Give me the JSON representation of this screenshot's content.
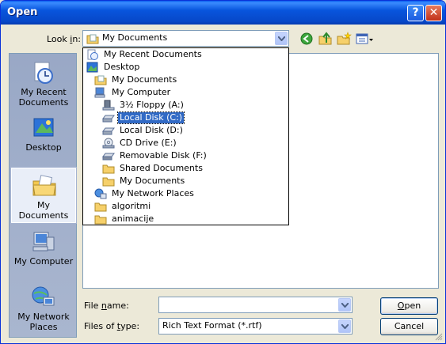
{
  "window": {
    "title": "Open",
    "help_symbol": "?",
    "close_symbol": "✕"
  },
  "look_in": {
    "label_prefix": "Look ",
    "label_accel": "i",
    "label_suffix": "n:",
    "value": "My Documents"
  },
  "toolbar": {
    "icons": [
      "back-icon",
      "up-folder-icon",
      "new-folder-icon",
      "views-menu-icon"
    ]
  },
  "places": [
    {
      "label": "My Recent Documents",
      "icon": "recent-documents-icon"
    },
    {
      "label": "Desktop",
      "icon": "desktop-icon"
    },
    {
      "label": "My Documents",
      "icon": "my-documents-icon",
      "selected": true
    },
    {
      "label": "My Computer",
      "icon": "my-computer-icon"
    },
    {
      "label": "My Network Places",
      "icon": "network-places-icon"
    }
  ],
  "dropdown": {
    "items": [
      {
        "label": "My Recent Documents",
        "icon": "recent-documents-icon",
        "indent": 0
      },
      {
        "label": "Desktop",
        "icon": "desktop-icon",
        "indent": 0
      },
      {
        "label": "My Documents",
        "icon": "folder-icon",
        "indent": 1
      },
      {
        "label": "My Computer",
        "icon": "computer-icon",
        "indent": 1
      },
      {
        "label": "3½ Floppy (A:)",
        "icon": "floppy-icon",
        "indent": 2
      },
      {
        "label": "Local Disk (C:)",
        "icon": "hard-disk-icon",
        "indent": 2,
        "active": true
      },
      {
        "label": "Local Disk (D:)",
        "icon": "hard-disk-icon",
        "indent": 2
      },
      {
        "label": "CD Drive (E:)",
        "icon": "cd-drive-icon",
        "indent": 2
      },
      {
        "label": "Removable Disk (F:)",
        "icon": "removable-disk-icon",
        "indent": 2
      },
      {
        "label": "Shared Documents",
        "icon": "folder-icon",
        "indent": 2
      },
      {
        "label": "My Documents",
        "icon": "folder-icon",
        "indent": 2
      },
      {
        "label": "My Network Places",
        "icon": "network-places-icon",
        "indent": 1
      },
      {
        "label": "algoritmi",
        "icon": "folder-icon",
        "indent": 1
      },
      {
        "label": "animacije",
        "icon": "folder-icon",
        "indent": 1
      }
    ]
  },
  "file_name": {
    "label_prefix": "File ",
    "label_accel": "n",
    "label_suffix": "ame:",
    "value": ""
  },
  "files_of_type": {
    "label_prefix": "Files of ",
    "label_accel": "t",
    "label_suffix": "ype:",
    "value": "Rich Text Format (*.rtf)"
  },
  "buttons": {
    "open_accel": "O",
    "open_rest": "pen",
    "cancel": "Cancel"
  },
  "colors": {
    "titlebar": "#0855DD",
    "selection": "#316AC5",
    "places_bar": "#A9B6CF",
    "dialog_bg": "#ECE9D8"
  }
}
